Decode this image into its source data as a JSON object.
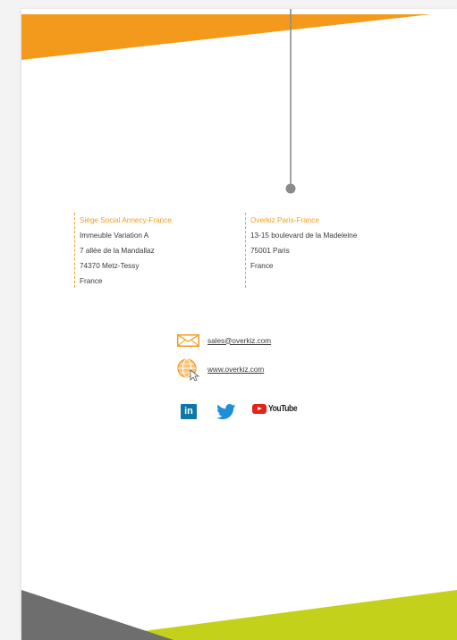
{
  "colors": {
    "orange": "#f39a1c",
    "lime": "#c3d11a",
    "gray": "#6e6e6e",
    "line": "#8a8a8a"
  },
  "addresses": [
    {
      "title": "Siège Social Annecy-France",
      "lines": [
        "Immeuble Variation A",
        "7 allée de la Mandallaz",
        "74370 Metz-Tessy",
        "France"
      ]
    },
    {
      "title": "Overkiz Paris-France",
      "lines": [
        "13-15 boulevard de la Madeleine",
        "75001 Paris",
        "France"
      ]
    }
  ],
  "contact": {
    "email": "sales@overkiz.com",
    "website": "www.overkiz.com",
    "email_icon": "envelope-icon",
    "web_icon": "globe-cursor-icon"
  },
  "social": {
    "linkedin_label": "in",
    "linkedin_icon": "linkedin-icon",
    "twitter_icon": "twitter-bird-icon",
    "youtube_label": "YouTube",
    "youtube_icon": "youtube-play-icon"
  }
}
